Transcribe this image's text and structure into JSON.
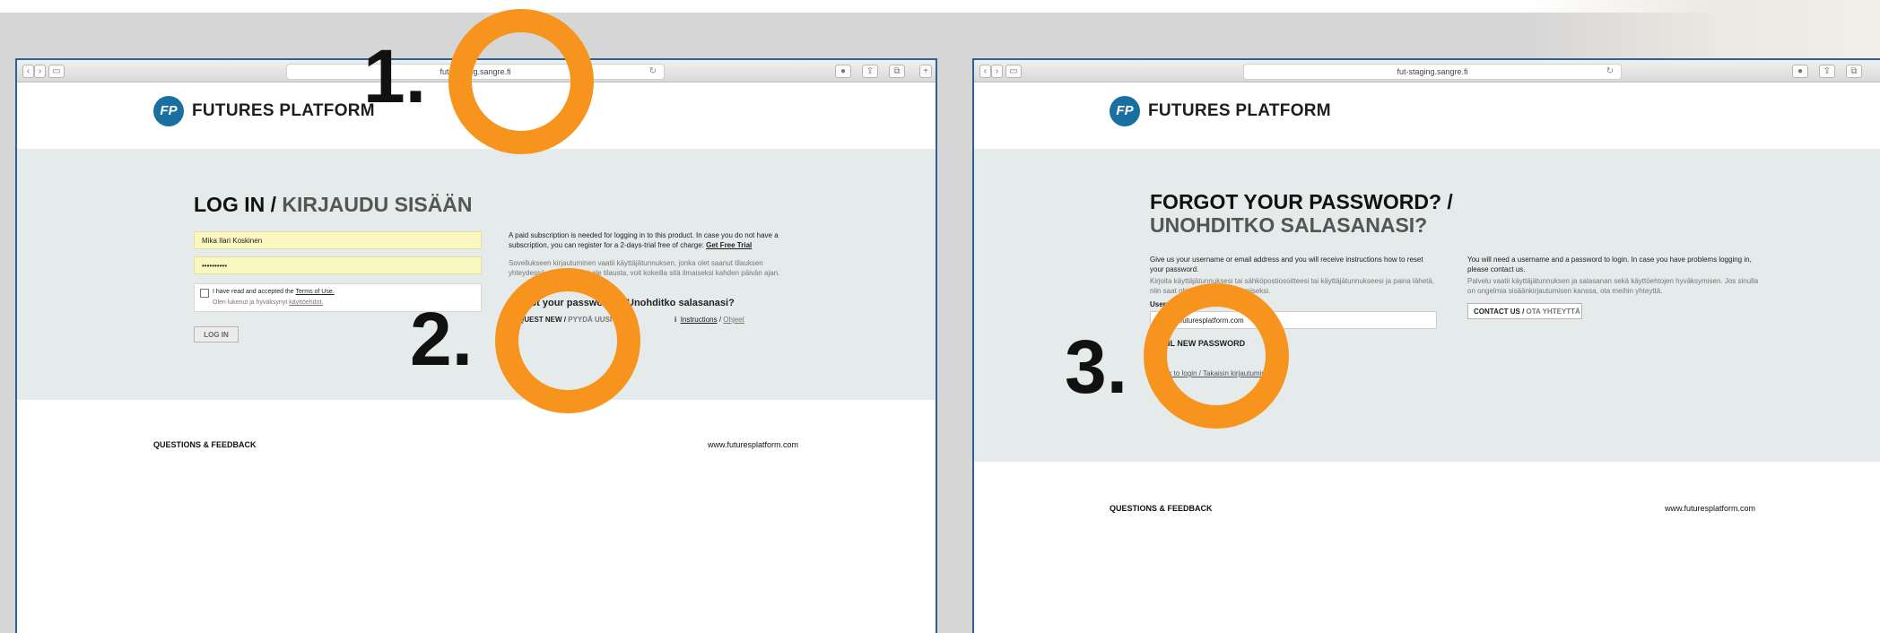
{
  "colors": {
    "background": "#d6d6d6",
    "window_border": "#2f6294",
    "band": "#e5eaea",
    "input_fill": "#fbf7c1",
    "logo": "#1a6fa1",
    "marker_ring": "#f7941d"
  },
  "left_window": {
    "url": "fut-staging.sangre.fi",
    "logo_mark": "FP",
    "logo_text": "FUTURES PLATFORM",
    "title_main": "LOG IN /",
    "title_alt": "KIRJAUDU SISÄÄN",
    "username_value": "Mika Ilari Koskinen",
    "password_value": "••••••••••",
    "terms_line1_prefix": "I have read and accepted the",
    "terms_link": "Terms of Use.",
    "terms_line2_prefix": "Olen lukenut ja hyväksynyt",
    "terms_link2": "käyttöehdot.",
    "login_button": "LOG IN",
    "info_text1": "A paid subscription is needed for logging in to this product. In case you do not have a subscription, you can register for a 2-days-trial free of charge:",
    "info_link": "Get Free Trial",
    "info_text2": "Sovellukseen kirjautuminen vaatii käyttäjätunnuksen, jonka olet saanut tilauksen yhteydessä. Jos sinulla ei ole tilausta, voit kokeilla sitä ilmaiseksi kahden päivän ajan.",
    "forgot_heading": "Forgot your password? / Unohditko salasanasi?",
    "request_new": "REQUEST NEW",
    "request_new_fi": "PYYDÄ UUSI",
    "instructions": "Instructions",
    "instructions_fi": "Ohjeet",
    "footer_left": "QUESTIONS & FEEDBACK",
    "footer_right": "www.futuresplatform.com"
  },
  "right_window": {
    "url": "fut-staging.sangre.fi",
    "logo_mark": "FP",
    "logo_text": "FUTURES PLATFORM",
    "title_line1": "FORGOT YOUR PASSWORD? /",
    "title_line2": "UNOHDITKO SALASANASI?",
    "instr_en": "Give us your username or email address and you will receive instructions how to reset your password.",
    "instr_fi": "Kirjoita käyttäjätunnuksesi tai sähköpostiosoitteesi tai käyttäjätunnukseesi ja paina lähetä, niin saat ohjeet salasanan luomiseksi.",
    "email_value": "mika@futuresplatform.com",
    "email_label": "Username / Email",
    "send_button": "EMAIL NEW PASSWORD",
    "back_link": "« Back to login / Takaisin kirjautumiseen",
    "contact_en": "You will need a username and a password to login. In case you have problems logging in, please contact us.",
    "contact_fi": "Palvelu vaatii käyttäjätunnuksen ja salasanan sekä käyttöehtojen hyväksymisen. Jos sinulla on ongelmia sisäänkirjautumisen kanssa, ota meihin yhteyttä.",
    "contact_button": "CONTACT US /",
    "contact_button_fi": "OTA YHTEYTTÄ",
    "footer_left": "QUESTIONS & FEEDBACK",
    "footer_right": "www.futuresplatform.com"
  },
  "markers": [
    {
      "label": "1."
    },
    {
      "label": "2."
    },
    {
      "label": "3."
    }
  ]
}
